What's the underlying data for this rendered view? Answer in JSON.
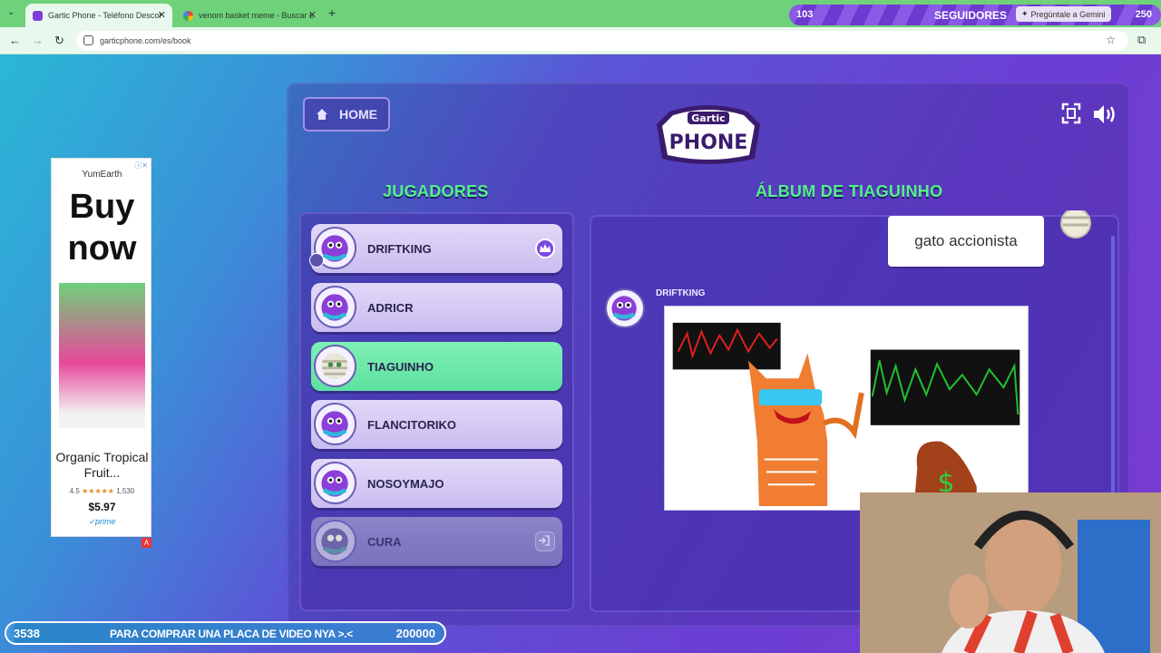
{
  "browser": {
    "tabs": [
      {
        "title": "Gartic Phone - Teléfono Descor",
        "active": true
      },
      {
        "title": "venom basket meme - Buscar c",
        "active": false
      }
    ],
    "url": "garticphone.com/es/book",
    "gemini_label": "Pregúntale a Gemini"
  },
  "followers": {
    "current": "103",
    "label": "SEGUIDORES",
    "goal": "250"
  },
  "header": {
    "home_label": "HOME"
  },
  "players_section": {
    "title": "JUGADORES",
    "players": [
      {
        "name": "DRIFTKING",
        "state": "host"
      },
      {
        "name": "ADRICR",
        "state": "normal"
      },
      {
        "name": "TIAGUINHO",
        "state": "selected"
      },
      {
        "name": "FLANCITORIKO",
        "state": "normal"
      },
      {
        "name": "NOSOYMAJO",
        "state": "normal"
      },
      {
        "name": "CURA",
        "state": "left"
      }
    ]
  },
  "album": {
    "title": "ÁLBUM DE TIAGUINHO",
    "phrase": "gato accionista",
    "drawing_author": "DRIFTKING"
  },
  "ad": {
    "brand": "YumEarth",
    "headline": "Buy now",
    "product": "Organic Tropical Fruit...",
    "rating": "4.5",
    "reviews": "1,530",
    "price": "$5.97",
    "prime": "prime"
  },
  "donation_goal": {
    "current": "3538",
    "label": "PARA COMPRAR UNA PLACA DE VIDEO NYA >.<",
    "goal": "200000",
    "progress": 0.018
  },
  "colors": {
    "accent_green": "#54f08a",
    "selected_row": "#6eeaa9",
    "panel_purple": "#5b3fd0"
  }
}
